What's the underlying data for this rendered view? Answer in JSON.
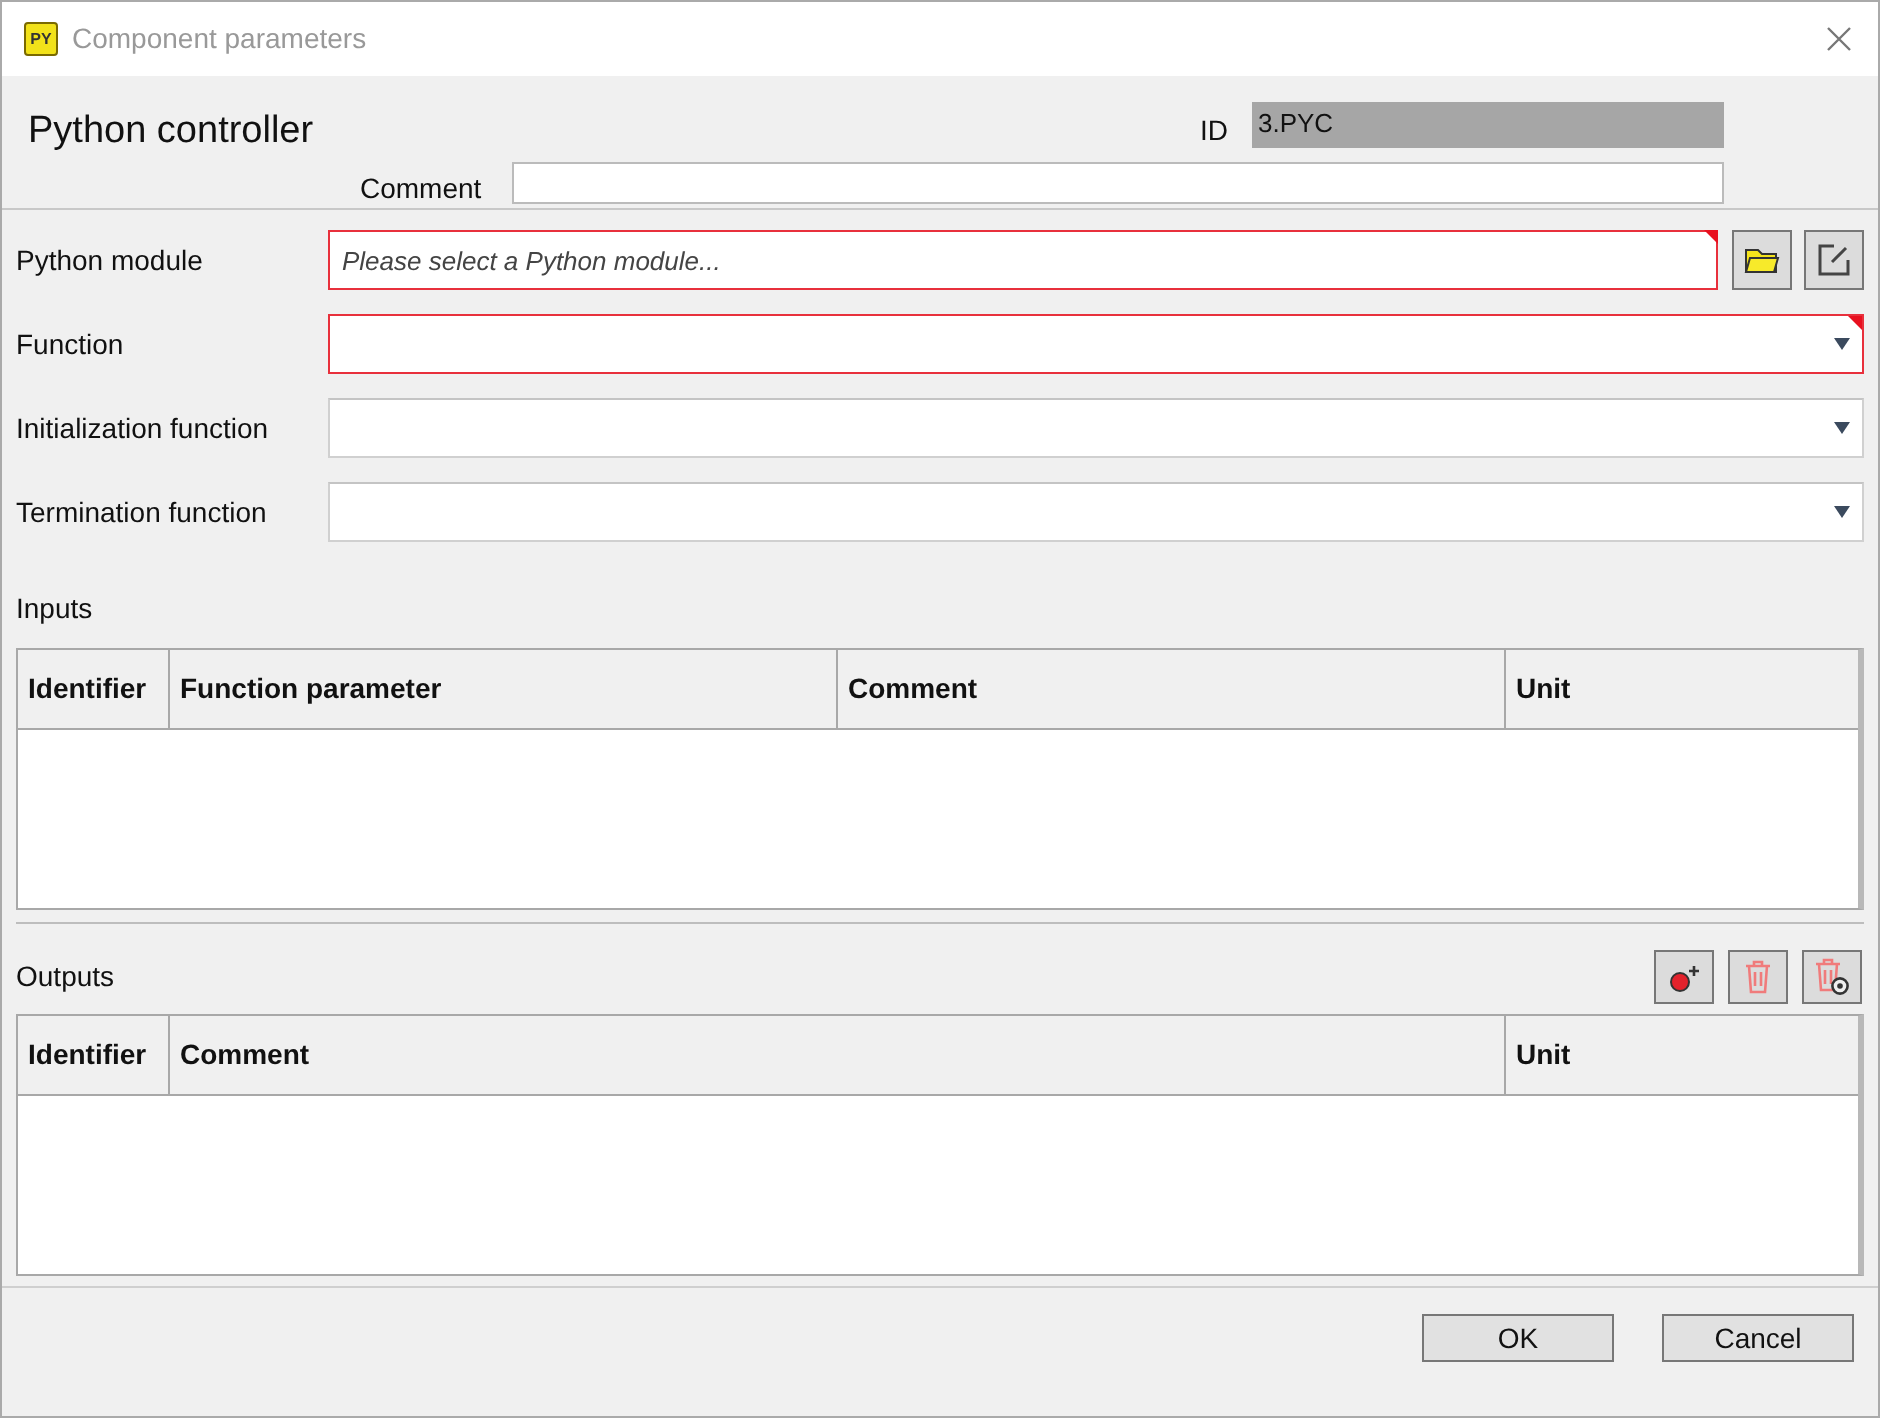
{
  "window": {
    "app_badge": "PY",
    "title": "Component parameters"
  },
  "header": {
    "name": "Python controller",
    "id_label": "ID",
    "id_value": "3.PYC",
    "comment_label": "Comment"
  },
  "fields": [
    {
      "label": "Python module",
      "kind": "file",
      "required": true,
      "placeholder": "Please select a Python module..."
    },
    {
      "label": "Function",
      "kind": "dropdown",
      "required": true
    },
    {
      "label": "Initialization function",
      "kind": "dropdown",
      "required": false
    },
    {
      "label": "Termination function",
      "kind": "dropdown",
      "required": false
    }
  ],
  "inputs": {
    "title": "Inputs",
    "columns": [
      "Identifier",
      "Function parameter",
      "Comment",
      "Unit"
    ]
  },
  "outputs": {
    "title": "Outputs",
    "columns": [
      "Identifier",
      "Comment",
      "Unit"
    ]
  },
  "buttons": [
    "OK",
    "Cancel"
  ]
}
